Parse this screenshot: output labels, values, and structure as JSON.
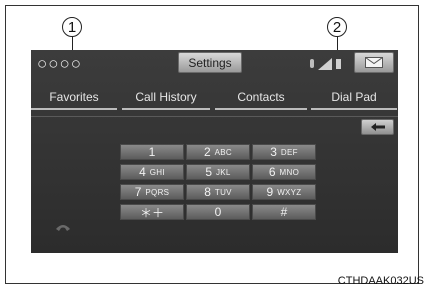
{
  "callouts": [
    "1",
    "2"
  ],
  "caption": "CTHDAAK032US",
  "screen": {
    "title": "○○○○",
    "settings_label": "Settings",
    "status_icons": [
      "bluetooth-icon",
      "signal-strength-icon",
      "battery-icon"
    ],
    "mail_icon": "envelope-icon",
    "tabs": [
      {
        "label": "Favorites"
      },
      {
        "label": "Call History"
      },
      {
        "label": "Contacts"
      },
      {
        "label": "Dial Pad"
      }
    ],
    "backspace_icon": "left-arrow-icon",
    "keypad": [
      {
        "digit": "1",
        "letters": ""
      },
      {
        "digit": "2",
        "letters": "ABC"
      },
      {
        "digit": "3",
        "letters": "DEF"
      },
      {
        "digit": "4",
        "letters": "GHI"
      },
      {
        "digit": "5",
        "letters": "JKL"
      },
      {
        "digit": "6",
        "letters": "MNO"
      },
      {
        "digit": "7",
        "letters": "PQRS"
      },
      {
        "digit": "8",
        "letters": "TUV"
      },
      {
        "digit": "9",
        "letters": "WXYZ"
      },
      {
        "digit": "＊＋",
        "letters": ""
      },
      {
        "digit": "0",
        "letters": ""
      },
      {
        "digit": "#",
        "letters": ""
      }
    ],
    "call_icon": "phone-handset-icon"
  }
}
